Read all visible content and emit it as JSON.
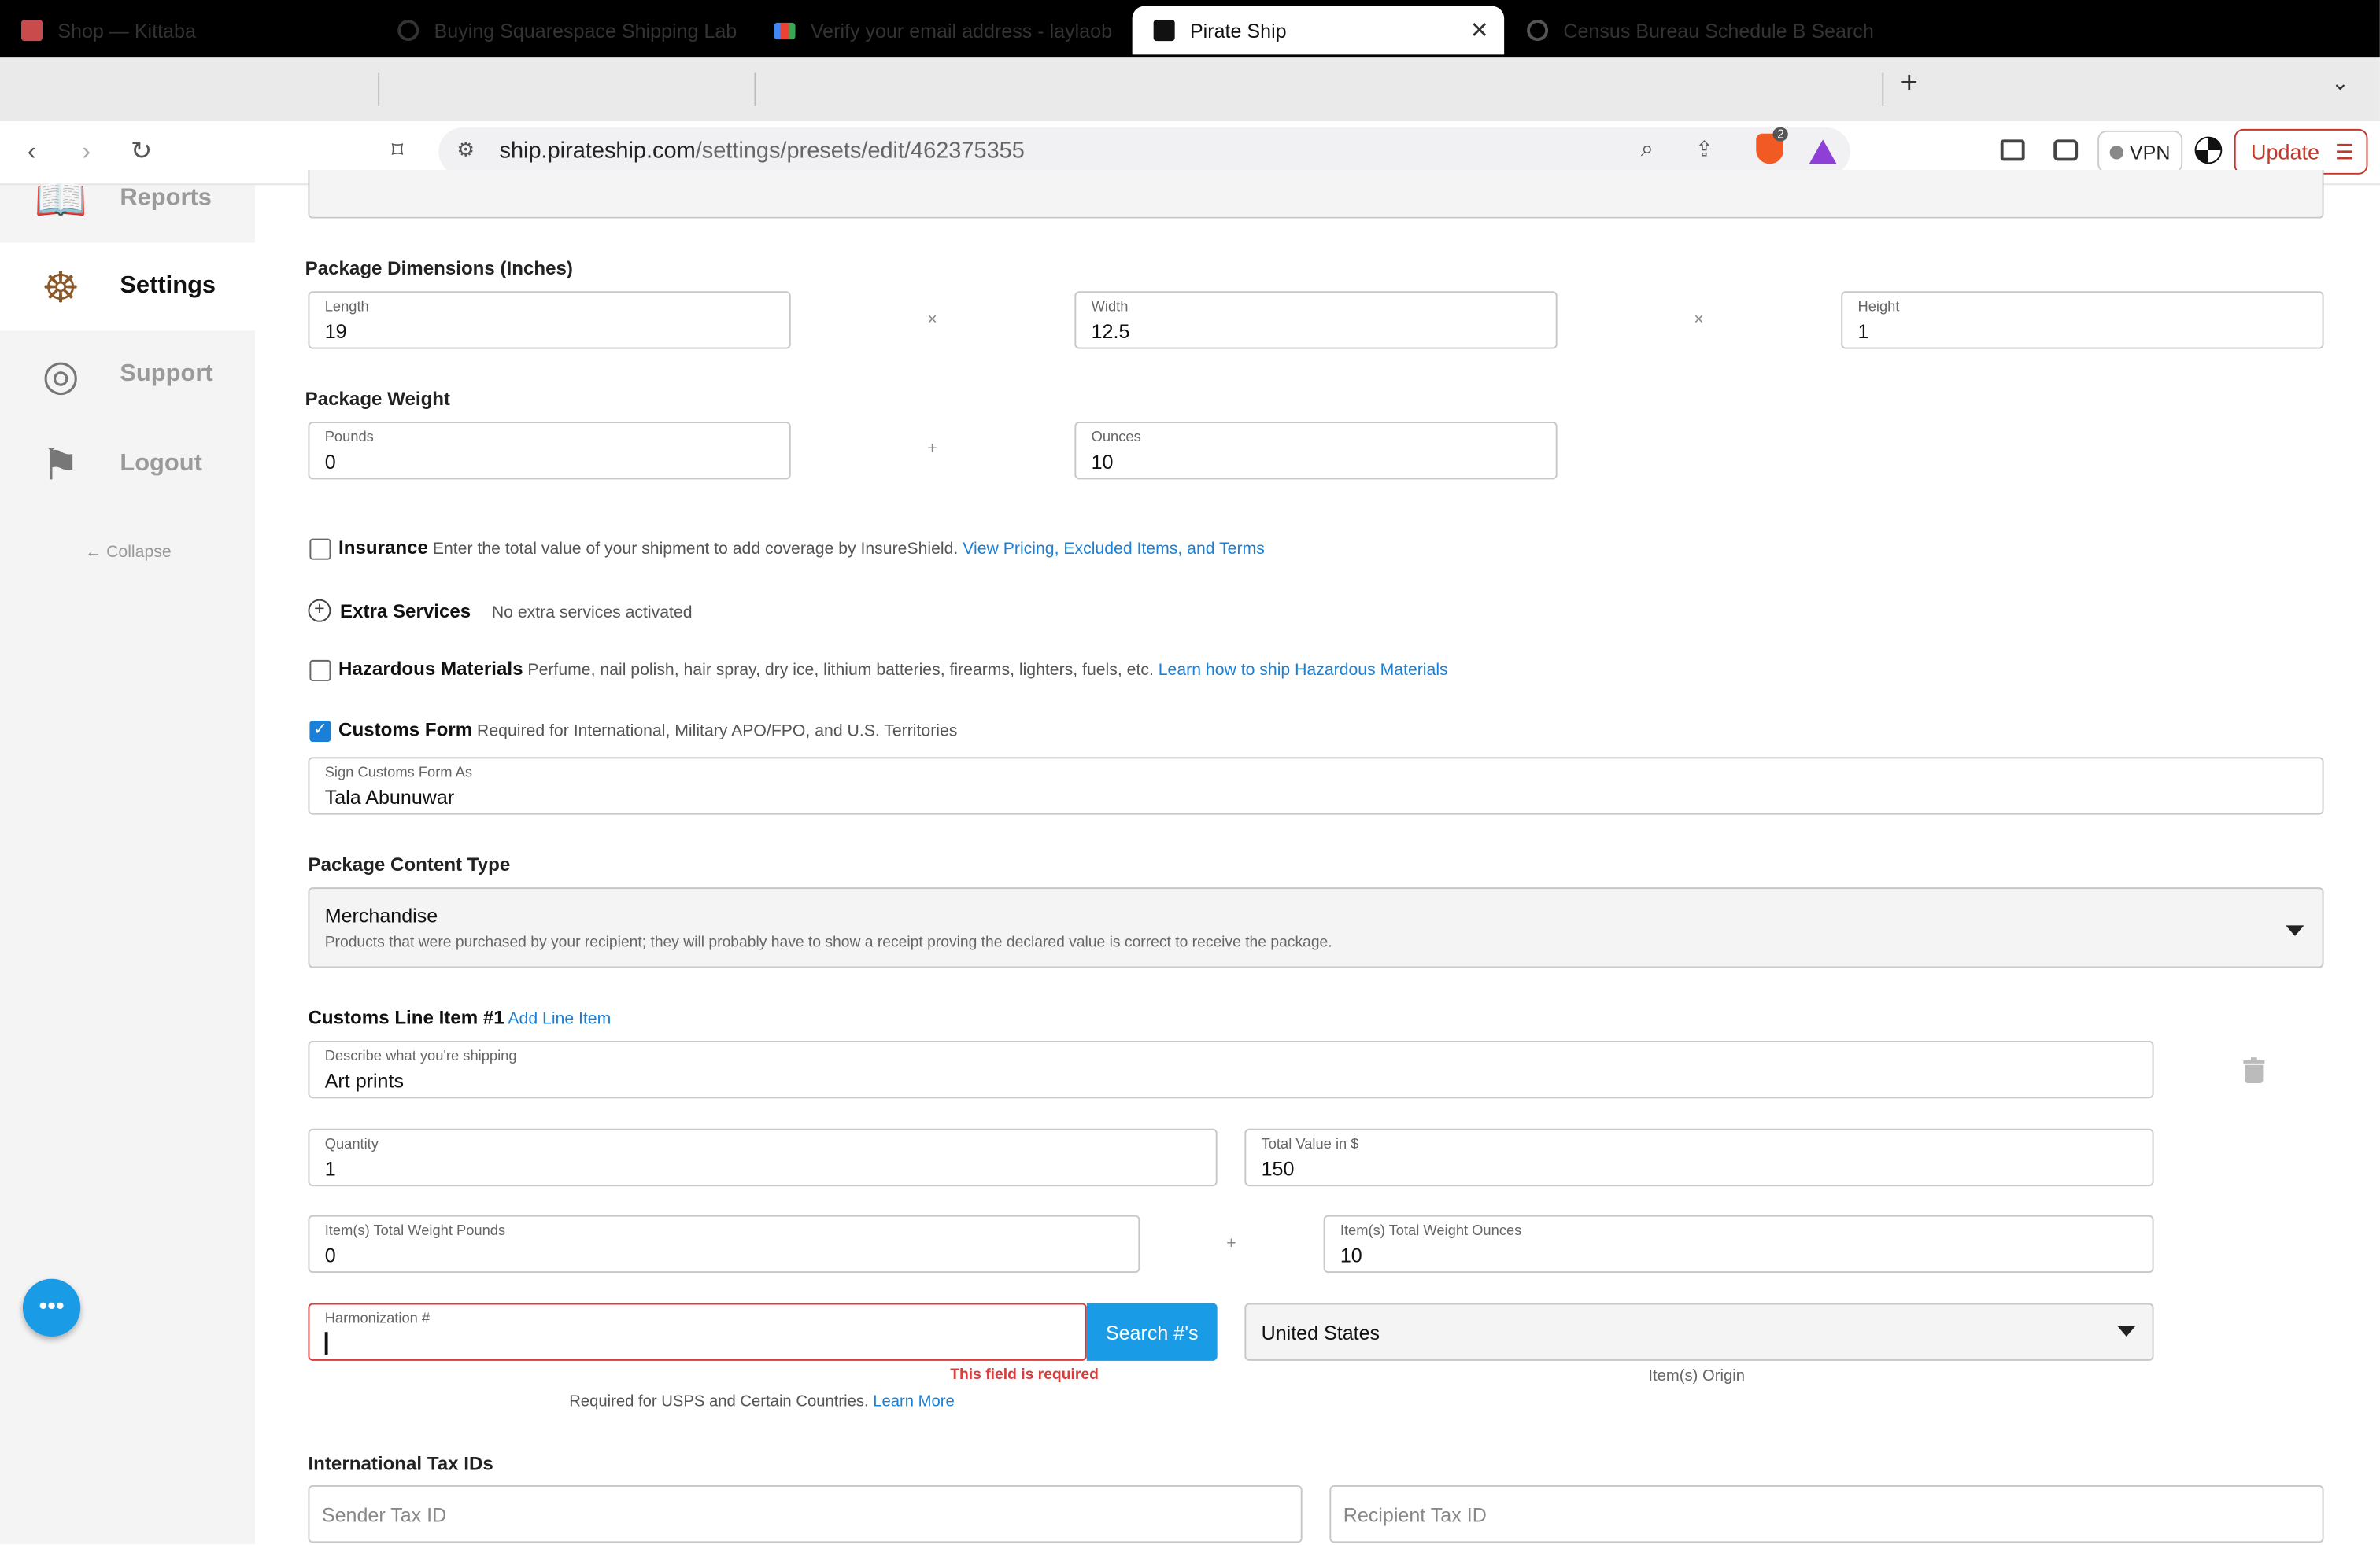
{
  "browser": {
    "tabs": [
      {
        "label": "Shop — Kittaba",
        "icon": "shop-favicon-icon",
        "active": false
      },
      {
        "label": "Buying Squarespace Shipping Lab",
        "icon": "squarespace-favicon-icon",
        "active": false
      },
      {
        "label": "Verify your email address - laylaob",
        "icon": "gmail-favicon-icon",
        "active": false
      },
      {
        "label": "Pirate Ship",
        "icon": "pirate-ship-favicon-icon",
        "active": true
      },
      {
        "label": "Census Bureau Schedule B Search",
        "icon": "census-favicon-icon",
        "active": false
      }
    ],
    "url_domain": "ship.pirateship.com",
    "url_path": "/settings/presets/edit/462375355",
    "vpn_label": "VPN",
    "update_label": "Update",
    "brave_badge": "2"
  },
  "sidebar": {
    "items": [
      {
        "label": "Reports",
        "icon": "reports-icon"
      },
      {
        "label": "Settings",
        "icon": "ship-wheel-icon"
      },
      {
        "label": "Support",
        "icon": "life-ring-icon"
      },
      {
        "label": "Logout",
        "icon": "logout-icon"
      }
    ],
    "collapse_label": "← Collapse"
  },
  "dimensions": {
    "title": "Package Dimensions (Inches)",
    "length_label": "Length",
    "length_value": "19",
    "width_label": "Width",
    "width_value": "12.5",
    "height_label": "Height",
    "height_value": "1",
    "times": "×"
  },
  "weight": {
    "title": "Package Weight",
    "pounds_label": "Pounds",
    "pounds_value": "0",
    "ounces_label": "Ounces",
    "ounces_value": "10",
    "plus": "+"
  },
  "insurance": {
    "label": "Insurance",
    "desc": "Enter the total value of your shipment to add coverage by InsureShield.",
    "link": "View Pricing, Excluded Items, and Terms",
    "checked": false
  },
  "extra_services": {
    "label": "Extra Services",
    "status": "No extra services activated"
  },
  "hazardous": {
    "label": "Hazardous Materials",
    "desc": "Perfume, nail polish, hair spray, dry ice, lithium batteries, firearms, lighters, fuels, etc.",
    "link": "Learn how to ship Hazardous Materials",
    "checked": false
  },
  "customs": {
    "label": "Customs Form",
    "desc": "Required for International, Military APO/FPO, and U.S. Territories",
    "checked": true,
    "sign_label": "Sign Customs Form As",
    "sign_value": "Tala Abunuwar"
  },
  "content_type": {
    "title": "Package Content Type",
    "value": "Merchandise",
    "desc": "Products that were purchased by your recipient; they will probably have to show a receipt proving the declared value is correct to receive the package."
  },
  "line_item": {
    "title": "Customs Line Item #1",
    "add_link": "Add Line Item",
    "describe_label": "Describe what you're shipping",
    "describe_value": "Art prints",
    "quantity_label": "Quantity",
    "quantity_value": "1",
    "total_value_label": "Total Value in $",
    "total_value_value": "150",
    "weight_pounds_label": "Item(s) Total Weight Pounds",
    "weight_pounds_value": "0",
    "weight_ounces_label": "Item(s) Total Weight Ounces",
    "weight_ounces_value": "10",
    "harmonization_label": "Harmonization #",
    "harmonization_value": "",
    "search_button": "Search #'s",
    "error": "This field is required",
    "required_note": "Required for USPS and Certain Countries.",
    "learn_more": "Learn More",
    "origin_value": "United States",
    "origin_label": "Item(s) Origin"
  },
  "tax_ids": {
    "title": "International Tax IDs",
    "sender_placeholder": "Sender Tax ID",
    "recipient_placeholder": "Recipient Tax ID"
  },
  "colors": {
    "accent_blue": "#1a9be6",
    "link_blue": "#1a7fd6",
    "error_red": "#d93c3c",
    "update_red": "#c0392b"
  }
}
